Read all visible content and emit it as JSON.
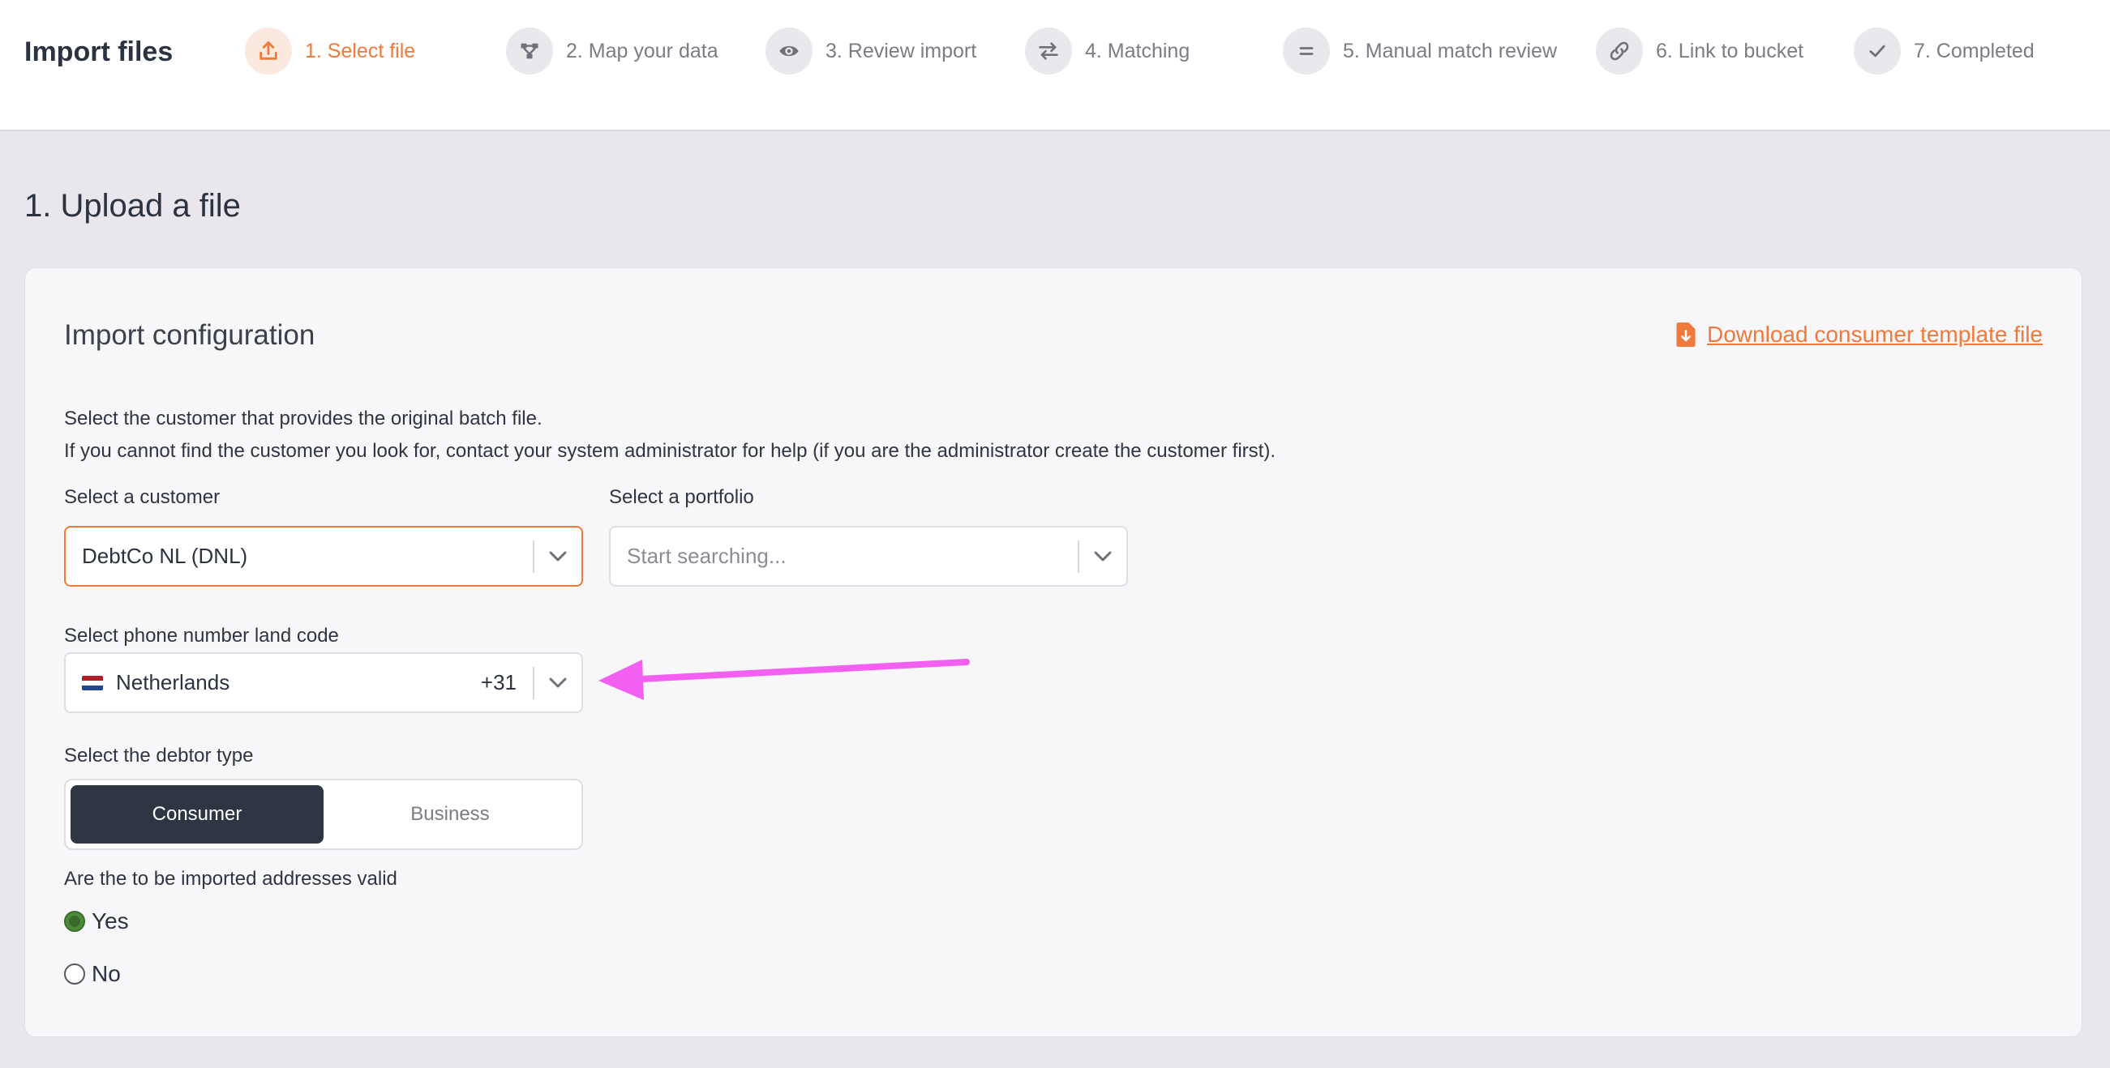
{
  "header": {
    "title": "Import files",
    "steps": [
      {
        "label": "1. Select file",
        "icon": "upload-icon",
        "active": true
      },
      {
        "label": "2. Map your data",
        "icon": "diagram-icon",
        "active": false
      },
      {
        "label": "3. Review import",
        "icon": "eye-icon",
        "active": false
      },
      {
        "label": "4. Matching",
        "icon": "swap-arrows-icon",
        "active": false
      },
      {
        "label": "5. Manual match review",
        "icon": "equals-icon",
        "active": false
      },
      {
        "label": "6. Link to bucket",
        "icon": "link-icon",
        "active": false
      },
      {
        "label": "7. Completed",
        "icon": "check-icon",
        "active": false
      }
    ]
  },
  "section_title": "1. Upload a file",
  "config": {
    "title": "Import configuration",
    "download_label": "Download consumer template file",
    "description_line1": "Select the customer that provides the original batch file.",
    "description_line2": "If you cannot find the customer you look for, contact your system administrator for help (if you are the administrator create the customer first).",
    "customer_label": "Select a customer",
    "customer_value": "DebtCo NL (DNL)",
    "portfolio_label": "Select a portfolio",
    "portfolio_placeholder": "Start searching...",
    "phone_label": "Select phone number land code",
    "phone_country": "Netherlands",
    "phone_code": "+31",
    "debtor_label": "Select the debtor type",
    "debtor_options": [
      "Consumer",
      "Business"
    ],
    "debtor_selected": "Consumer",
    "address_label": "Are the to be imported addresses valid",
    "address_options": [
      "Yes",
      "No"
    ],
    "address_selected": "Yes"
  },
  "colors": {
    "accent": "#ef7a3c",
    "dark": "#2e3644",
    "annotation_arrow": "#f35ff0"
  }
}
